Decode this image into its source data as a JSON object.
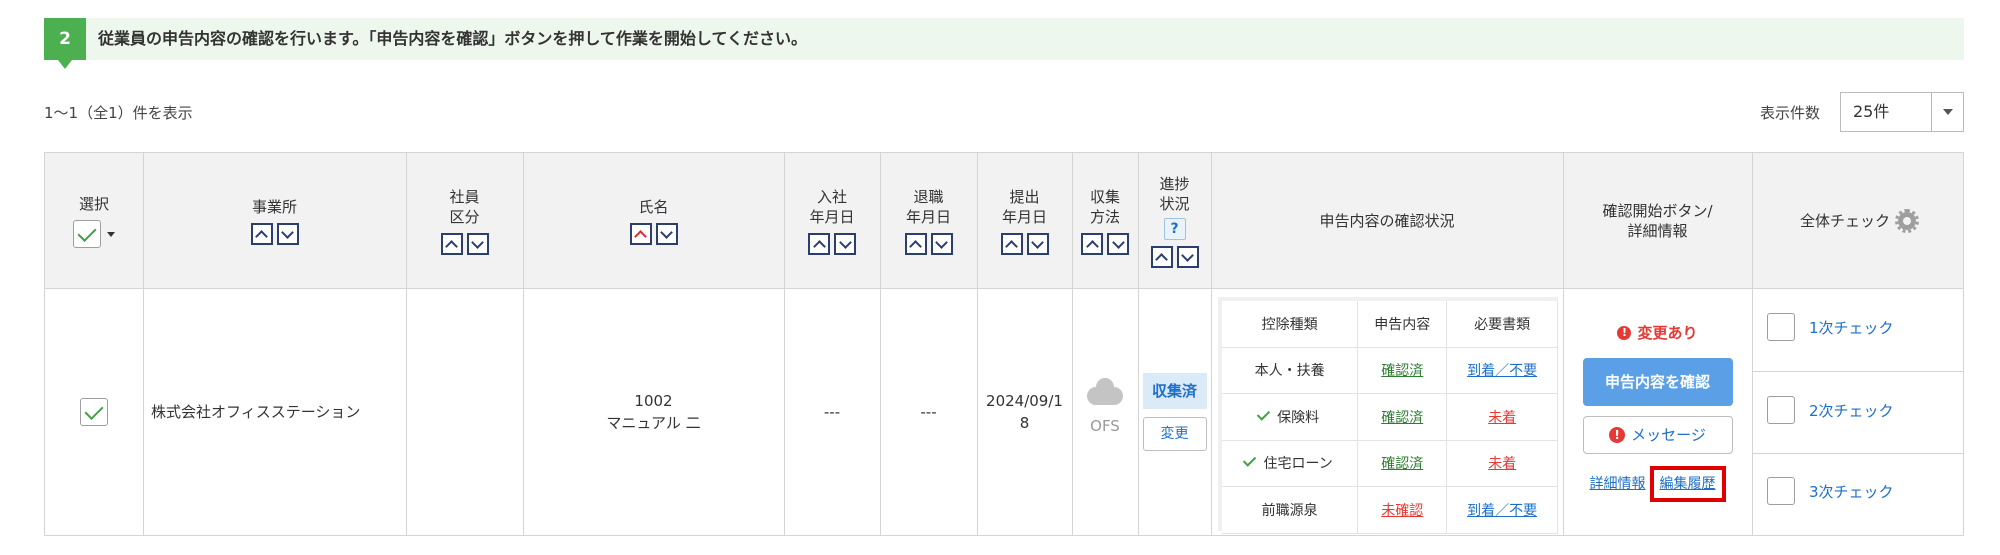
{
  "instruction": {
    "step_number": "2",
    "text": "従業員の申告内容の確認を行います。「申告内容を確認」ボタンを押して作業を開始してください。"
  },
  "list_info": {
    "count_text": "1〜1（全1）件を表示",
    "per_page_label": "表示件数",
    "per_page_value": "25件"
  },
  "headers": {
    "select": "選択",
    "office": "事業所",
    "emp_type_1": "社員",
    "emp_type_2": "区分",
    "name": "氏名",
    "join_1": "入社",
    "join_2": "年月日",
    "leave_1": "退職",
    "leave_2": "年月日",
    "submit_1": "提出",
    "submit_2": "年月日",
    "collect_1": "収集",
    "collect_2": "方法",
    "progress_1": "進捗",
    "progress_2": "状況",
    "help": "?",
    "confirm_status": "申告内容の確認状況",
    "start_1": "確認開始ボタン/",
    "start_2": "詳細情報",
    "all_check": "全体チェック"
  },
  "row": {
    "selected": true,
    "office": "株式会社オフィスステーション",
    "emp_id": "1002",
    "name": "マニュアル 二",
    "join_date": "---",
    "leave_date": "---",
    "submit_date_1": "2024/09/1",
    "submit_date_2": "8",
    "collect_method": "OFS",
    "progress_badge": "収集済",
    "change_button": "変更",
    "deductions": {
      "headers": [
        "控除種類",
        "申告内容",
        "必要書類"
      ],
      "rows": [
        {
          "type": "本人・扶養",
          "content": "確認済",
          "docs": "到着／不要",
          "checked": false
        },
        {
          "type": "保険料",
          "content": "確認済",
          "docs": "未着",
          "checked": true
        },
        {
          "type": "住宅ローン",
          "content": "確認済",
          "docs": "未着",
          "checked": true
        },
        {
          "type": "前職源泉",
          "content": "未確認",
          "docs": "到着／不要",
          "checked": false
        }
      ]
    },
    "changed_note": "変更あり",
    "confirm_button": "申告内容を確認",
    "message_button": "メッセージ",
    "detail_link": "詳細情報",
    "history_link": "編集履歴",
    "checks": [
      "1次チェック",
      "2次チェック",
      "3次チェック"
    ]
  },
  "colors": {
    "accent_green": "#4caf50",
    "primary_blue": "#5b9fe6",
    "alert_red": "#e53935",
    "highlight_border": "#e00000"
  }
}
